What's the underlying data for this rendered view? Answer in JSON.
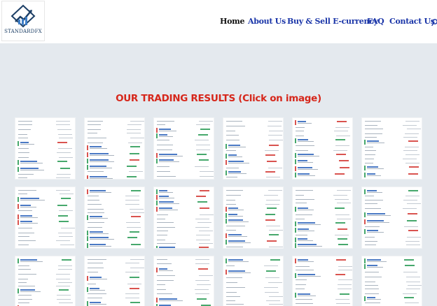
{
  "brand": {
    "name": "STANDARDFX",
    "logo_color": "#1d3f66"
  },
  "nav": {
    "items": [
      {
        "label": "Home",
        "active": true
      },
      {
        "label": "About Us",
        "active": false
      },
      {
        "label": "Buy & Sell E-currency",
        "active": false
      },
      {
        "label": "FAQ",
        "active": false
      },
      {
        "label": "Contact Us",
        "active": false
      }
    ],
    "search_icon": "search-icon"
  },
  "main": {
    "title": "OUR TRADING RESULTS (Click on image)",
    "title_color": "#d6271b",
    "thumbnail_count": 18
  },
  "colors": {
    "header_bg": "#ffffff",
    "page_bg": "#e4e9ee",
    "nav_link": "#1a35a8",
    "nav_active": "#111111"
  }
}
